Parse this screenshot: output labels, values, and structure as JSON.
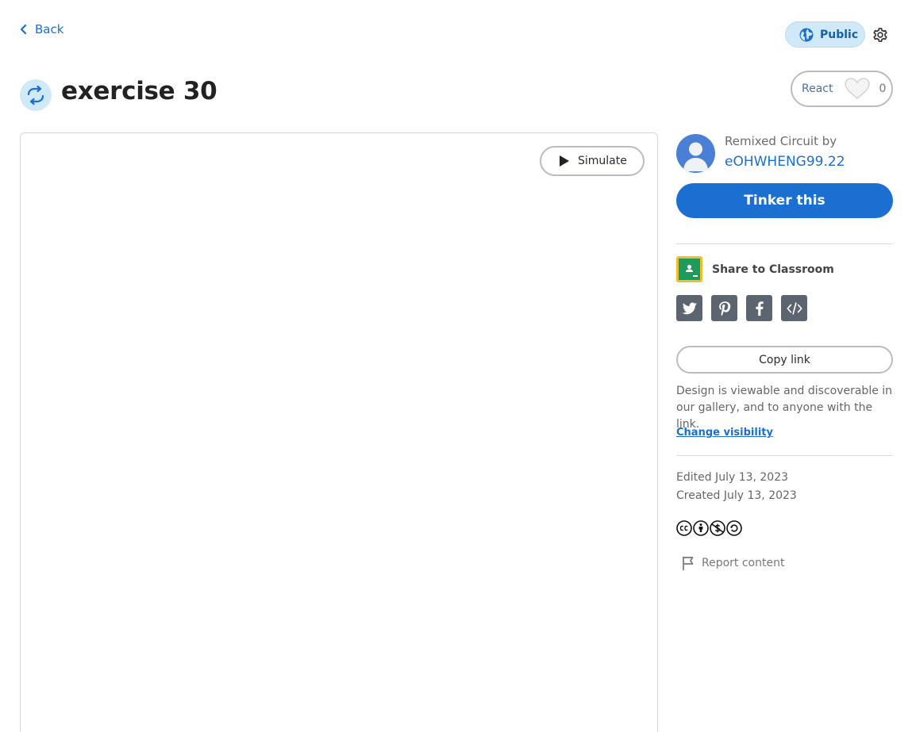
{
  "nav": {
    "back_label": "Back"
  },
  "header": {
    "visibility_label": "Public",
    "title": "exercise 30",
    "react_label": "React",
    "react_count": "0"
  },
  "canvas": {
    "simulate_label": "Simulate"
  },
  "sidebar": {
    "remix_label": "Remixed Circuit by",
    "author": "eOHWHENG99.22",
    "tinker_label": "Tinker this",
    "share_classroom_label": "Share to Classroom",
    "social_icons": [
      "twitter-icon",
      "pinterest-icon",
      "facebook-icon",
      "embed-code-icon"
    ],
    "copy_link_label": "Copy link",
    "visibility_desc": "Design is viewable and discoverable in our gallery, and to anyone with the link.",
    "change_visibility_label": "Change visibility",
    "edited": "Edited July 13, 2023",
    "created": "Created July 13, 2023",
    "license_icons": [
      "cc-icon",
      "by-icon",
      "nc-icon",
      "sa-icon"
    ],
    "report_label": "Report content"
  },
  "colors": {
    "accent": "#1a6fd1",
    "public_badge_bg": "#cfe9f9",
    "social_icon_bg": "#5c6470"
  }
}
